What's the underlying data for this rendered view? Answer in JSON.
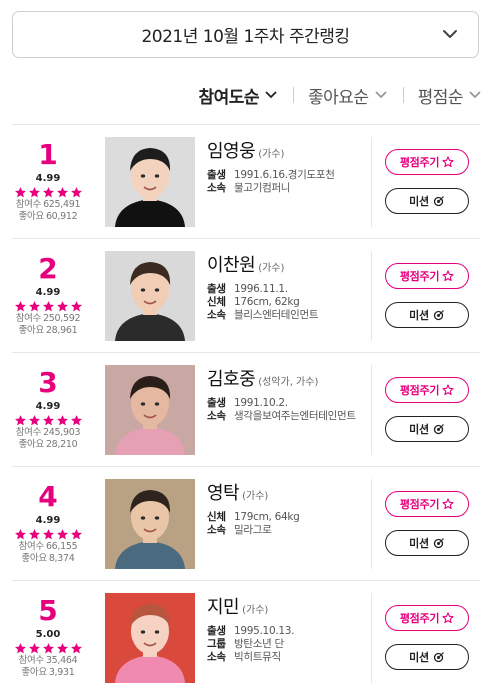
{
  "header": {
    "week_label": "2021년 10월 1주차 주간랭킹"
  },
  "sort": {
    "options": [
      {
        "label": "참여도순",
        "active": true
      },
      {
        "label": "좋아요순",
        "active": false
      },
      {
        "label": "평점순",
        "active": false
      }
    ]
  },
  "labels": {
    "participants": "참여수",
    "likes": "좋아요",
    "rate_button": "평점주기",
    "mission_button": "미션"
  },
  "colors": {
    "accent": "#e6007e",
    "text": "#222222"
  },
  "ranking": [
    {
      "rank": "1",
      "score": "4.99",
      "rating_fraction": 1.0,
      "participants": "625,491",
      "likes": "60,912",
      "name": "임영웅",
      "job": "(가수)",
      "details": [
        {
          "k": "출생",
          "v": "1991.6.16.경기도포천"
        },
        {
          "k": "소속",
          "v": "물고기컴퍼니"
        }
      ],
      "photo": {
        "bg": "#dcdcdc",
        "skin": "#f3d3bd",
        "hair": "#1d1d1d",
        "cloth": "#111111"
      }
    },
    {
      "rank": "2",
      "score": "4.99",
      "rating_fraction": 1.0,
      "participants": "250,592",
      "likes": "28,961",
      "name": "이찬원",
      "job": "(가수)",
      "details": [
        {
          "k": "출생",
          "v": "1996.11.1."
        },
        {
          "k": "신체",
          "v": "176cm, 62kg"
        },
        {
          "k": "소속",
          "v": "블리스엔터테인먼트"
        }
      ],
      "photo": {
        "bg": "#d9d9d9",
        "skin": "#f1cdb6",
        "hair": "#3a2a20",
        "cloth": "#2b2b2b"
      }
    },
    {
      "rank": "3",
      "score": "4.99",
      "rating_fraction": 1.0,
      "participants": "245,903",
      "likes": "28,210",
      "name": "김호중",
      "job": "(성악가, 가수)",
      "details": [
        {
          "k": "출생",
          "v": "1991.10.2."
        },
        {
          "k": "소속",
          "v": "생각을보여주는엔터테인먼트"
        }
      ],
      "photo": {
        "bg": "#c9a7a3",
        "skin": "#e5b9a1",
        "hair": "#2a1e18",
        "cloth": "#e6a0b4"
      }
    },
    {
      "rank": "4",
      "score": "4.99",
      "rating_fraction": 1.0,
      "participants": "66,155",
      "likes": "8,374",
      "name": "영탁",
      "job": "(가수)",
      "details": [
        {
          "k": "신체",
          "v": "179cm, 64kg"
        },
        {
          "k": "소속",
          "v": "밀라그로"
        }
      ],
      "photo": {
        "bg": "#b9a183",
        "skin": "#e9c6a8",
        "hair": "#2e241d",
        "cloth": "#4a6a80"
      }
    },
    {
      "rank": "5",
      "score": "5.00",
      "rating_fraction": 1.0,
      "participants": "35,464",
      "likes": "3,931",
      "name": "지민",
      "job": "(가수)",
      "details": [
        {
          "k": "출생",
          "v": "1995.10.13."
        },
        {
          "k": "그룹",
          "v": "방탄소년 단"
        },
        {
          "k": "소속",
          "v": "빅히트뮤직"
        }
      ],
      "photo": {
        "bg": "#d94a3c",
        "skin": "#f5d2c2",
        "hair": "#b8553f",
        "cloth": "#f08ab0"
      }
    }
  ]
}
